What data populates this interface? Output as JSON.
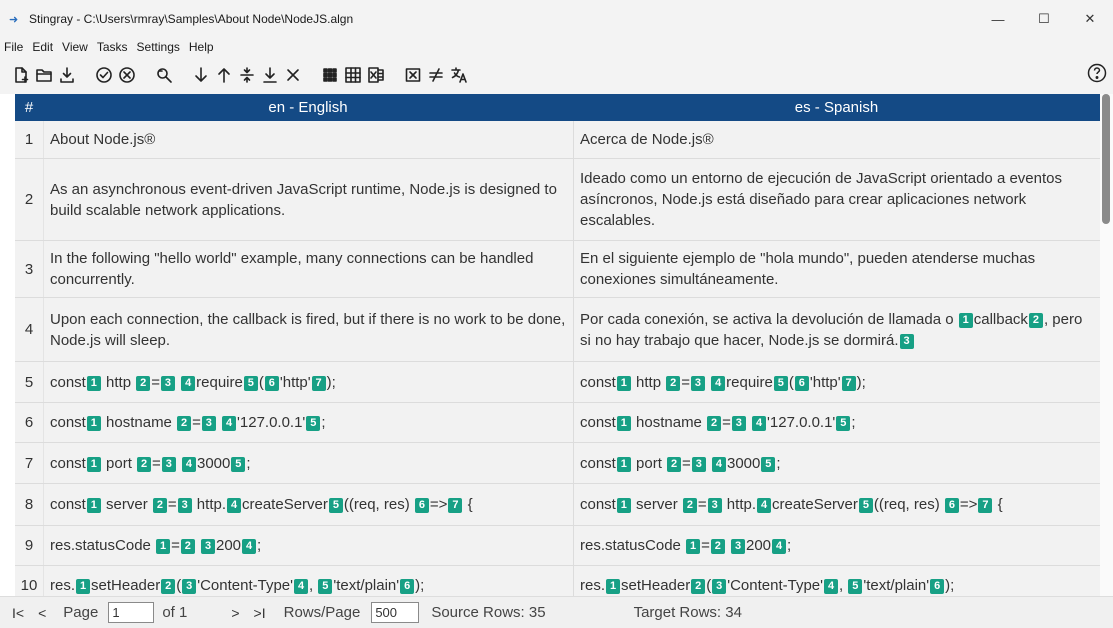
{
  "window": {
    "title": "Stingray - C:\\Users\\rmray\\Samples\\About Node\\NodeJS.algn",
    "minimize": "—",
    "maximize": "☐",
    "close": "✕"
  },
  "menu": [
    "File",
    "Edit",
    "View",
    "Tasks",
    "Settings",
    "Help"
  ],
  "toolbar_icons": [
    "new-file-icon",
    "open-folder-icon",
    "save-icon",
    "accept-icon",
    "reject-icon",
    "search-replace-icon",
    "move-down-icon",
    "move-up-icon",
    "split-icon",
    "merge-icon",
    "delete-icon",
    "grid-view-icon",
    "table-view-icon",
    "excel-icon",
    "clear-tags-icon",
    "not-equal-icon",
    "translate-icon",
    "help-icon"
  ],
  "grid": {
    "col_num": "#",
    "col_source": "en - English",
    "col_target": "es - Spanish",
    "rows": [
      {
        "n": "1",
        "src": "About Node.js®",
        "tgt": "Acerca de Node.js®"
      },
      {
        "n": "2",
        "src": "As an asynchronous event-driven JavaScript runtime, Node.js is designed to build scalable network applications.",
        "tgt": "Ideado como un entorno de ejecución de JavaScript orientado a eventos asíncronos, Node.js está diseñado para crear aplicaciones network escalables."
      },
      {
        "n": "3",
        "src": "In the following \"hello world\" example, many connections can be handled concurrently.",
        "tgt": "En el siguiente ejemplo de \"hola mundo\", pueden atenderse muchas conexiones simultáneamente."
      },
      {
        "n": "4",
        "src": "Upon each connection, the callback is fired, but if there is no work to be done, Node.js will sleep.",
        "tgt": "Por cada conexión, se activa la devolución de llamada o [1]callback[2], pero si no hay trabajo que hacer, Node.js se dormirá.[3]"
      },
      {
        "n": "5",
        "src": "const[1] http [2]=[3] [4]require[5]([6]'http'[7]);",
        "tgt": "const[1] http [2]=[3] [4]require[5]([6]'http'[7]);"
      },
      {
        "n": "6",
        "src": "const[1] hostname [2]=[3] [4]'127.0.0.1'[5];",
        "tgt": "const[1] hostname [2]=[3] [4]'127.0.0.1'[5];"
      },
      {
        "n": "7",
        "src": "const[1] port [2]=[3] [4]3000[5];",
        "tgt": "const[1] port [2]=[3] [4]3000[5];"
      },
      {
        "n": "8",
        "src": "const[1] server [2]=[3] http.[4]createServer[5]((req, res) [6]=>[7] {",
        "tgt": "const[1] server [2]=[3] http.[4]createServer[5]((req, res) [6]=>[7] {"
      },
      {
        "n": "9",
        "src": "res.statusCode [1]=[2] [3]200[4];",
        "tgt": "res.statusCode [1]=[2] [3]200[4];"
      },
      {
        "n": "10",
        "src": "res.[1]setHeader[2]([3]'Content-Type'[4], [5]'text/plain'[6]);",
        "tgt": "res.[1]setHeader[2]([3]'Content-Type'[4], [5]'text/plain'[6]);"
      }
    ]
  },
  "pager": {
    "first": "I<",
    "prev": "<",
    "page_label": "Page",
    "page_value": "1",
    "of_label": "of 1",
    "next": ">",
    "last": ">I",
    "rows_label": "Rows/Page",
    "rows_value": "500",
    "source_rows": "Source Rows: 35",
    "target_rows": "Target Rows: 34"
  },
  "colors": {
    "header": "#144a85",
    "tag": "#17a085",
    "row_bg": "#f2f2f2"
  }
}
